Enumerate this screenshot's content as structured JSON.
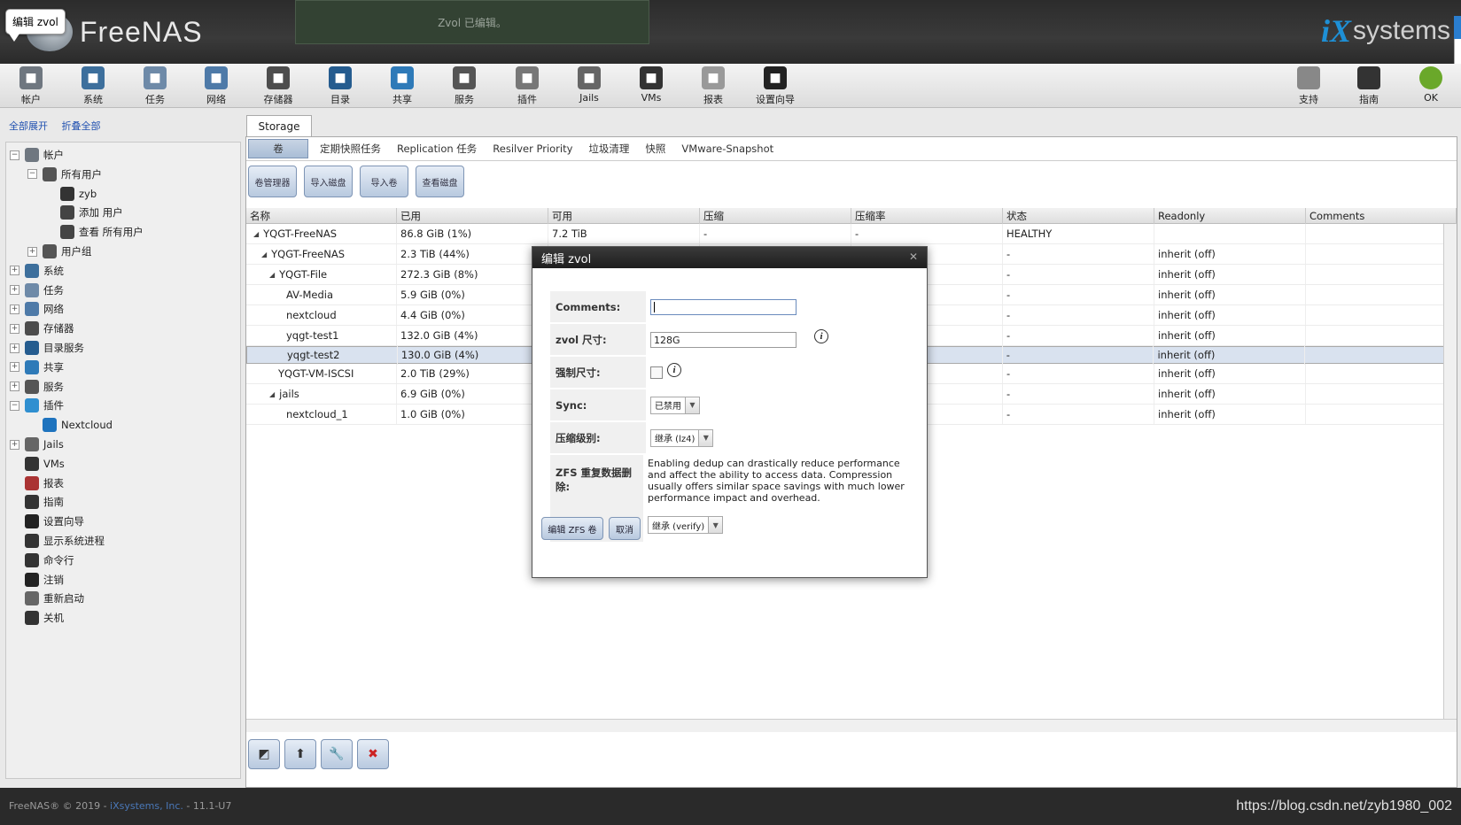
{
  "header": {
    "tooltip": "编辑 zvol",
    "logo": "FreeNAS",
    "notice": "Zvol 已编辑。",
    "brand_ix": "iX",
    "brand_systems": "systems"
  },
  "toolbar": {
    "items": [
      {
        "label": "帐户",
        "icon": "users-icon",
        "color": "#6f7780"
      },
      {
        "label": "系统",
        "icon": "system-icon",
        "color": "#3d6f9c"
      },
      {
        "label": "任务",
        "icon": "tasks-icon",
        "color": "#6e8aa8"
      },
      {
        "label": "网络",
        "icon": "network-icon",
        "color": "#4e7aa8"
      },
      {
        "label": "存储器",
        "icon": "storage-icon",
        "color": "#4d4d4d"
      },
      {
        "label": "目录",
        "icon": "directory-icon",
        "color": "#255c8f"
      },
      {
        "label": "共享",
        "icon": "sharing-icon",
        "color": "#2e7ab8"
      },
      {
        "label": "服务",
        "icon": "services-icon",
        "color": "#555"
      },
      {
        "label": "插件",
        "icon": "plugins-icon",
        "color": "#777"
      },
      {
        "label": "Jails",
        "icon": "jails-icon",
        "color": "#666"
      },
      {
        "label": "VMs",
        "icon": "vms-icon",
        "color": "#333"
      },
      {
        "label": "报表",
        "icon": "reports-icon",
        "color": "#999"
      },
      {
        "label": "设置向导",
        "icon": "wizard-icon",
        "color": "#222"
      }
    ],
    "right_items": [
      {
        "label": "支持",
        "icon": "support-icon",
        "color": "#888"
      },
      {
        "label": "指南",
        "icon": "guide-icon",
        "color": "#333"
      },
      {
        "label": "OK",
        "icon": "alert-ok-icon",
        "color": "#6aa82a"
      }
    ]
  },
  "sidebar": {
    "expand_all": "全部展开",
    "collapse_all": "折叠全部",
    "tree": [
      {
        "label": "帐户",
        "level": 0,
        "exp": "−",
        "icon": "users-icon",
        "color": "#6f7780"
      },
      {
        "label": "所有用户",
        "level": 1,
        "exp": "−",
        "icon": "user-group-icon",
        "color": "#555"
      },
      {
        "label": "zyb",
        "level": 2,
        "exp": "",
        "icon": "user-icon",
        "color": "#333"
      },
      {
        "label": "添加 用户",
        "level": 2,
        "exp": "",
        "icon": "add-user-icon",
        "color": "#444"
      },
      {
        "label": "查看 所有用户",
        "level": 2,
        "exp": "",
        "icon": "view-users-icon",
        "color": "#444"
      },
      {
        "label": "用户组",
        "level": 1,
        "exp": "+",
        "icon": "groups-icon",
        "color": "#555"
      },
      {
        "label": "系统",
        "level": 0,
        "exp": "+",
        "icon": "system-icon",
        "color": "#3d6f9c"
      },
      {
        "label": "任务",
        "level": 0,
        "exp": "+",
        "icon": "tasks-icon",
        "color": "#6e8aa8"
      },
      {
        "label": "网络",
        "level": 0,
        "exp": "+",
        "icon": "network-icon",
        "color": "#4e7aa8"
      },
      {
        "label": "存储器",
        "level": 0,
        "exp": "+",
        "icon": "storage-icon",
        "color": "#4d4d4d"
      },
      {
        "label": "目录服务",
        "level": 0,
        "exp": "+",
        "icon": "directory-icon",
        "color": "#255c8f"
      },
      {
        "label": "共享",
        "level": 0,
        "exp": "+",
        "icon": "sharing-icon",
        "color": "#2e7ab8"
      },
      {
        "label": "服务",
        "level": 0,
        "exp": "+",
        "icon": "services-icon",
        "color": "#555"
      },
      {
        "label": "插件",
        "level": 0,
        "exp": "−",
        "icon": "plugins-icon",
        "color": "#2f8fd0"
      },
      {
        "label": "Nextcloud",
        "level": 1,
        "exp": "",
        "icon": "nextcloud-icon",
        "color": "#1e73be"
      },
      {
        "label": "Jails",
        "level": 0,
        "exp": "+",
        "icon": "jails-icon",
        "color": "#666"
      },
      {
        "label": "VMs",
        "level": 0,
        "exp": "",
        "icon": "vms-icon",
        "color": "#333"
      },
      {
        "label": "报表",
        "level": 0,
        "exp": "",
        "icon": "reports-icon",
        "color": "#a33"
      },
      {
        "label": "指南",
        "level": 0,
        "exp": "",
        "icon": "guide-icon",
        "color": "#333"
      },
      {
        "label": "设置向导",
        "level": 0,
        "exp": "",
        "icon": "wizard-icon",
        "color": "#222"
      },
      {
        "label": "显示系统进程",
        "level": 0,
        "exp": "",
        "icon": "processes-icon",
        "color": "#333"
      },
      {
        "label": "命令行",
        "level": 0,
        "exp": "",
        "icon": "shell-icon",
        "color": "#333"
      },
      {
        "label": "注销",
        "level": 0,
        "exp": "",
        "icon": "logout-icon",
        "color": "#222"
      },
      {
        "label": "重新启动",
        "level": 0,
        "exp": "",
        "icon": "reboot-icon",
        "color": "#666"
      },
      {
        "label": "关机",
        "level": 0,
        "exp": "",
        "icon": "shutdown-icon",
        "color": "#333"
      }
    ]
  },
  "main": {
    "tab": "Storage",
    "subtabs": [
      "卷",
      "定期快照任务",
      "Replication 任务",
      "Resilver Priority",
      "垃圾清理",
      "快照",
      "VMware-Snapshot"
    ],
    "actions": [
      "卷管理器",
      "导入磁盘",
      "导入卷",
      "查看磁盘"
    ],
    "columns": [
      "名称",
      "已用",
      "可用",
      "压缩",
      "压缩率",
      "状态",
      "Readonly",
      "Comments"
    ],
    "rows": [
      {
        "name": "YQGT-FreeNAS",
        "indent": 0,
        "tri": "◢",
        "used": "86.8 GiB (1%)",
        "avail": "7.2 TiB",
        "comp": "-",
        "ratio": "-",
        "status": "HEALTHY",
        "readonly": "",
        "comments": ""
      },
      {
        "name": "YQGT-FreeNAS",
        "indent": 1,
        "tri": "◢",
        "used": "2.3 TiB (44%)",
        "avail": "",
        "comp": "",
        "ratio": "",
        "status": "-",
        "readonly": "inherit (off)",
        "comments": ""
      },
      {
        "name": "YQGT-File",
        "indent": 2,
        "tri": "◢",
        "used": "272.3 GiB (8%)",
        "avail": "",
        "comp": "",
        "ratio": "",
        "status": "-",
        "readonly": "inherit (off)",
        "comments": ""
      },
      {
        "name": "AV-Media",
        "indent": 3,
        "tri": "",
        "used": "5.9 GiB (0%)",
        "avail": "",
        "comp": "",
        "ratio": "",
        "status": "-",
        "readonly": "inherit (off)",
        "comments": ""
      },
      {
        "name": "nextcloud",
        "indent": 3,
        "tri": "",
        "used": "4.4 GiB (0%)",
        "avail": "",
        "comp": "",
        "ratio": "",
        "status": "-",
        "readonly": "inherit (off)",
        "comments": ""
      },
      {
        "name": "yqgt-test1",
        "indent": 3,
        "tri": "",
        "used": "132.0 GiB (4%)",
        "avail": "",
        "comp": "",
        "ratio": "",
        "status": "-",
        "readonly": "inherit (off)",
        "comments": ""
      },
      {
        "name": "yqgt-test2",
        "indent": 3,
        "tri": "",
        "used": "130.0 GiB (4%)",
        "avail": "",
        "comp": "",
        "ratio": "",
        "status": "-",
        "readonly": "inherit (off)",
        "comments": "",
        "selected": true
      },
      {
        "name": "YQGT-VM-ISCSI",
        "indent": 2,
        "tri": "",
        "used": "2.0 TiB (29%)",
        "avail": "",
        "comp": "",
        "ratio": "",
        "status": "-",
        "readonly": "inherit (off)",
        "comments": ""
      },
      {
        "name": "jails",
        "indent": 2,
        "tri": "◢",
        "used": "6.9 GiB (0%)",
        "avail": "",
        "comp": "",
        "ratio": "",
        "status": "-",
        "readonly": "inherit (off)",
        "comments": ""
      },
      {
        "name": "nextcloud_1",
        "indent": 3,
        "tri": "",
        "used": "1.0 GiB (0%)",
        "avail": "",
        "comp": "",
        "ratio": "",
        "status": "-",
        "readonly": "inherit (off)",
        "comments": ""
      }
    ]
  },
  "dialog": {
    "title": "编辑 zvol",
    "comments_label": "Comments:",
    "comments_value": "",
    "size_label": "zvol 尺寸:",
    "size_value": "128G",
    "force_label": "强制尺寸:",
    "sync_label": "Sync:",
    "sync_value": "已禁用",
    "compression_label": "压缩级别:",
    "compression_value": "继承 (lz4)",
    "dedup_label": "ZFS 重复数据删除:",
    "dedup_warning": "Enabling dedup can drastically reduce performance and affect the ability to access data. Compression usually offers similar space savings with much lower performance impact and overhead.",
    "dedup_value": "继承 (verify)",
    "submit": "编辑 ZFS 卷",
    "cancel": "取消"
  },
  "footer": {
    "copyright": "FreeNAS® © 2019 - ",
    "company": "iXsystems, Inc.",
    "version": " - 11.1-U7",
    "watermark": "https://blog.csdn.net/zyb1980_002"
  }
}
